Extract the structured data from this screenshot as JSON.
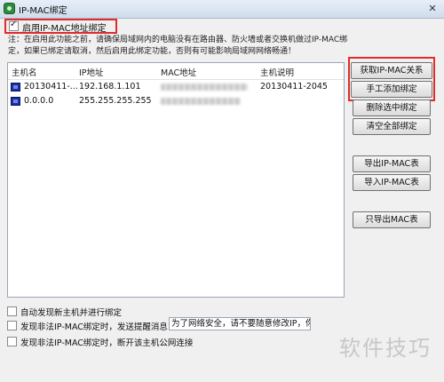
{
  "window": {
    "title": "IP-MAC绑定",
    "close_glyph": "✕"
  },
  "top_checkbox": {
    "label": "启用IP-MAC地址绑定",
    "checked": true
  },
  "notice": {
    "line1": "注：在启用此功能之前，请确保局域网内的电脑没有在路由器、防火墙或者交换机做过IP-MAC绑",
    "line2": "定，如果已绑定请取消，然后启用此绑定功能，否则有可能影响局域网网络畅通！"
  },
  "table": {
    "headers": [
      "主机名",
      "IP地址",
      "MAC地址",
      "主机说明"
    ],
    "rows": [
      {
        "host": "20130411-...",
        "ip": "192.168.1.101",
        "desc": "20130411-2045"
      },
      {
        "host": "0.0.0.0",
        "ip": "255.255.255.255",
        "desc": ""
      }
    ]
  },
  "buttons": {
    "get_ip_mac": "获取IP-MAC关系",
    "manual_add": "手工添加绑定",
    "delete_selected": "删除选中绑定",
    "clear_all": "清空全部绑定",
    "export_table": "导出IP-MAC表",
    "import_table": "导入IP-MAC表",
    "export_mac_only": "只导出MAC表"
  },
  "options": {
    "auto_discover": {
      "label": "自动发现新主机并进行绑定",
      "checked": false
    },
    "send_message": {
      "label": "发现非法IP-MAC绑定时，发送提醒消息",
      "checked": false,
      "message_value": "为了网络安全，请不要随意修改IP，你的"
    },
    "disconnect": {
      "label": "发现非法IP-MAC绑定时，断开该主机公网连接",
      "checked": false
    }
  },
  "colors": {
    "highlight_red": "#e02c2c",
    "host_icon": "#1c2f9e"
  }
}
